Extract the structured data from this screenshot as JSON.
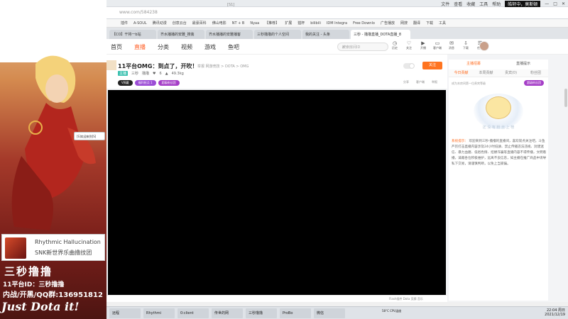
{
  "browser": {
    "url": "www.com/584238",
    "window_user": "皓轩中，莫斯顿",
    "menu": [
      "文件",
      "查看",
      "收藏",
      "工具",
      "帮助"
    ],
    "favorites": [
      "插件",
      "A-SOUL",
      "腾讯动漫",
      "创意云台",
      "最豪百科",
      "佛山电影",
      "NT + B",
      "Nyaa",
      "【推荐】",
      "扩展",
      "猎杯",
      "bilibili",
      "IDM Integra",
      "Free Downlo",
      "广告播放",
      "网搜",
      "翻译",
      "下载",
      "工具"
    ],
    "tabs": [
      "【CO】干将一b站",
      "齐水播播的安雅_搜装",
      "齐水播播的安雅播客",
      "三秒撸撸的个人空间",
      "我的关注 - 头条",
      "三秒 - 撸撸直播_DOTA直播_8"
    ]
  },
  "site": {
    "nav": [
      "首页",
      "直播",
      "分类",
      "视频",
      "游戏",
      "鱼吧"
    ],
    "search_placeholder": "搜索房间ID",
    "header_icons": [
      "历史",
      "关注",
      "开播",
      "客户端",
      "消息",
      "下载",
      "任务"
    ]
  },
  "overlay": {
    "tiny_label": "[S1]",
    "chat_label": "[S]欢迎来到[S]",
    "song_title": "Rhythmic Hallucination",
    "song_sub": "SNK新世界乐曲撸抆团",
    "stream_title": "三秒撸撸",
    "platform_id": "11平台ID：三秒撸撸",
    "qq": "内战/开黑/QQ群:136951812",
    "tagline": "Just Dota it!"
  },
  "room": {
    "title": "11平台OMG：到点了，开吹！",
    "category": "举报  网游竞技 > DOTA > OMG",
    "tag": "主播",
    "anchor": "三秒",
    "anchor_label": "撸撸",
    "fans": "6",
    "heat": "49.3kg",
    "badges": [
      "V佩戴",
      "福利抢点 1",
      "超级粉丝团"
    ],
    "follow": "关注",
    "tools": [
      "分享",
      "客户端",
      "举报"
    ]
  },
  "player": {
    "flash_tip": "Flash插件  Dota  竞猜  音乐"
  },
  "sidebar": {
    "tabs1": [
      "主播招募",
      "直播提示"
    ],
    "tabs2": [
      "今日贡献",
      "本周贡献",
      "贵宾(0)",
      "粉丝团"
    ],
    "rank_text": "成为本房间第一位贵宾等级",
    "rank_btn": "超级粉丝团",
    "nodata": "还 没 有 粉 丝 上 榜",
    "notice_label": "系统提示：",
    "notice": "欢迎来到三秒·撸撸的直播间，喜欢就点关注吧。斗鱼严厉打击直播内容涉及24小时低质、禁止传播违法违规、封建迷信、暴力血腥、低俗色情、招嫖诈骗等直播内容不得传播，文明看播，诚邀各位积极维护，远离不良信息，如主播在推广商品中诱导私下交易，请谨慎判断，以免上当受骗。"
  },
  "taskbar": {
    "items": [
      "远程",
      "Rhythmi",
      "0:client",
      "传世的网",
      "三秒撸撸",
      "ProBo",
      "微信"
    ],
    "weather": "58°C CPU温度",
    "time": "22:04 周日",
    "date": "2021/12/19"
  }
}
